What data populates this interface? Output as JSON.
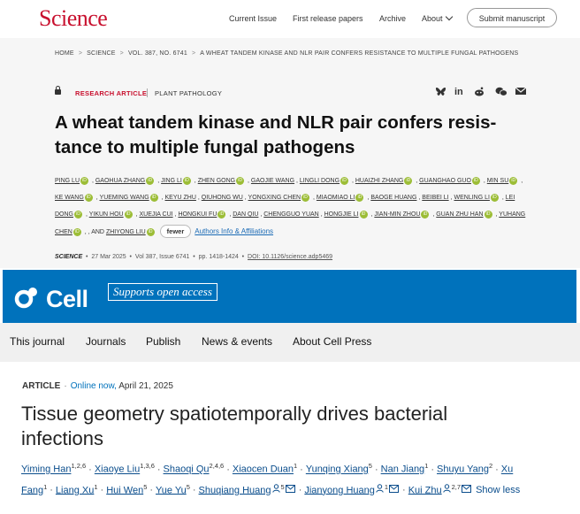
{
  "science": {
    "logo": "Science",
    "nav": [
      "Current Issue",
      "First release papers",
      "Archive",
      "About"
    ],
    "submit_label": "Submit manuscript",
    "breadcrumb": [
      "HOME",
      "SCIENCE",
      "VOL. 387, NO. 6741",
      "A WHEAT TANDEM KINASE AND NLR PAIR CONFERS RESISTANCE TO MULTIPLE FUNGAL PATHOGENS"
    ],
    "article_type": "RESEARCH ARTICLE",
    "subject": "PLANT PATHOLOGY",
    "share_icons": [
      "bluesky-icon",
      "linkedin-icon",
      "reddit-icon",
      "wechat-icon",
      "email-icon"
    ],
    "title_line1": "A wheat tandem kinase and NLR pair confers resis-",
    "title_line2": "tance to multiple fungal pathogens",
    "authors": [
      {
        "name": "PING LU",
        "orcid": true
      },
      {
        "name": "GAOHUA ZHANG",
        "orcid": true
      },
      {
        "name": "JING LI",
        "orcid": true
      },
      {
        "name": "ZHEN GONG",
        "orcid": true
      },
      {
        "name": "GAOJIE WANG",
        "orcid": false
      },
      {
        "name": "LINGLI DONG",
        "orcid": true
      },
      {
        "name": "HUAIZHI ZHANG",
        "orcid": true
      },
      {
        "name": "GUANGHAO GUO",
        "orcid": true
      },
      {
        "name": "MIN SU",
        "orcid": true
      },
      {
        "name": "KE WANG",
        "orcid": true
      },
      {
        "name": "YUEMING WANG",
        "orcid": true
      },
      {
        "name": "KEYU ZHU",
        "orcid": false
      },
      {
        "name": "QIUHONG WU",
        "orcid": false
      },
      {
        "name": "YONGXING CHEN",
        "orcid": true
      },
      {
        "name": "MIAOMIAO LI",
        "orcid": true
      },
      {
        "name": "BAOGE HUANG",
        "orcid": false
      },
      {
        "name": "BEIBEI LI",
        "orcid": false
      },
      {
        "name": "WENLING LI",
        "orcid": true
      },
      {
        "name": "LEI DONG",
        "orcid": true
      },
      {
        "name": "YIKUN HOU",
        "orcid": true
      },
      {
        "name": "XUEJIA CUI",
        "orcid": false
      },
      {
        "name": "HONGKUI FU",
        "orcid": true
      },
      {
        "name": "DAN QIU",
        "orcid": false
      },
      {
        "name": "CHENGGUO YUAN",
        "orcid": false
      },
      {
        "name": "HONGJIE LI",
        "orcid": true
      },
      {
        "name": "JIAN-MIN ZHOU",
        "orcid": true
      },
      {
        "name": "GUAN ZHU HAN",
        "orcid": true
      },
      {
        "name": "YUHANG CHEN",
        "orcid": true
      }
    ],
    "last_author_prefix": ", AND",
    "last_author": "ZHIYONG LIU",
    "fewer_label": "fewer",
    "affiliations_label": "Authors Info & Affiliations",
    "journal": "SCIENCE",
    "date": "27 Mar 2025",
    "volume": "Vol 387, Issue 6741",
    "pages": "pp. 1418-1424",
    "doi": "DOI: 10.1126/science.adp5469"
  },
  "cell": {
    "logo": "Cell",
    "open_access": "Supports open access",
    "nav": [
      "This journal",
      "Journals",
      "Publish",
      "News & events",
      "About Cell Press"
    ],
    "article_type": "ARTICLE",
    "online": "Online now,",
    "date": "April 21, 2025",
    "title_line1": "Tissue geometry spatiotemporally drives bacterial",
    "title_line2": "infections",
    "authors": [
      {
        "name": "Yiming Han",
        "sup": "1,2,6"
      },
      {
        "name": "Xiaoye Liu",
        "sup": "1,3,6"
      },
      {
        "name": "Shaoqi Qu",
        "sup": "2,4,6"
      },
      {
        "name": "Xiaocen Duan",
        "sup": "1"
      },
      {
        "name": "Yunqing Xiang",
        "sup": "5"
      },
      {
        "name": "Nan Jiang",
        "sup": "1"
      },
      {
        "name": "Shuyu Yang",
        "sup": "2"
      },
      {
        "name": "Xu Fang",
        "sup": "1"
      },
      {
        "name": "Liang Xu",
        "sup": "1"
      },
      {
        "name": "Hui Wen",
        "sup": "5"
      },
      {
        "name": "Yue Yu",
        "sup": "5"
      },
      {
        "name": "Shuqiang Huang",
        "sup": "5"
      },
      {
        "name": "Jianyong Huang",
        "sup": "1"
      },
      {
        "name": "Kui Zhu",
        "sup": "2,7"
      }
    ],
    "show_less": "Show less",
    "link_color": "#0a4d8c",
    "brand_color": "#0072bc"
  }
}
